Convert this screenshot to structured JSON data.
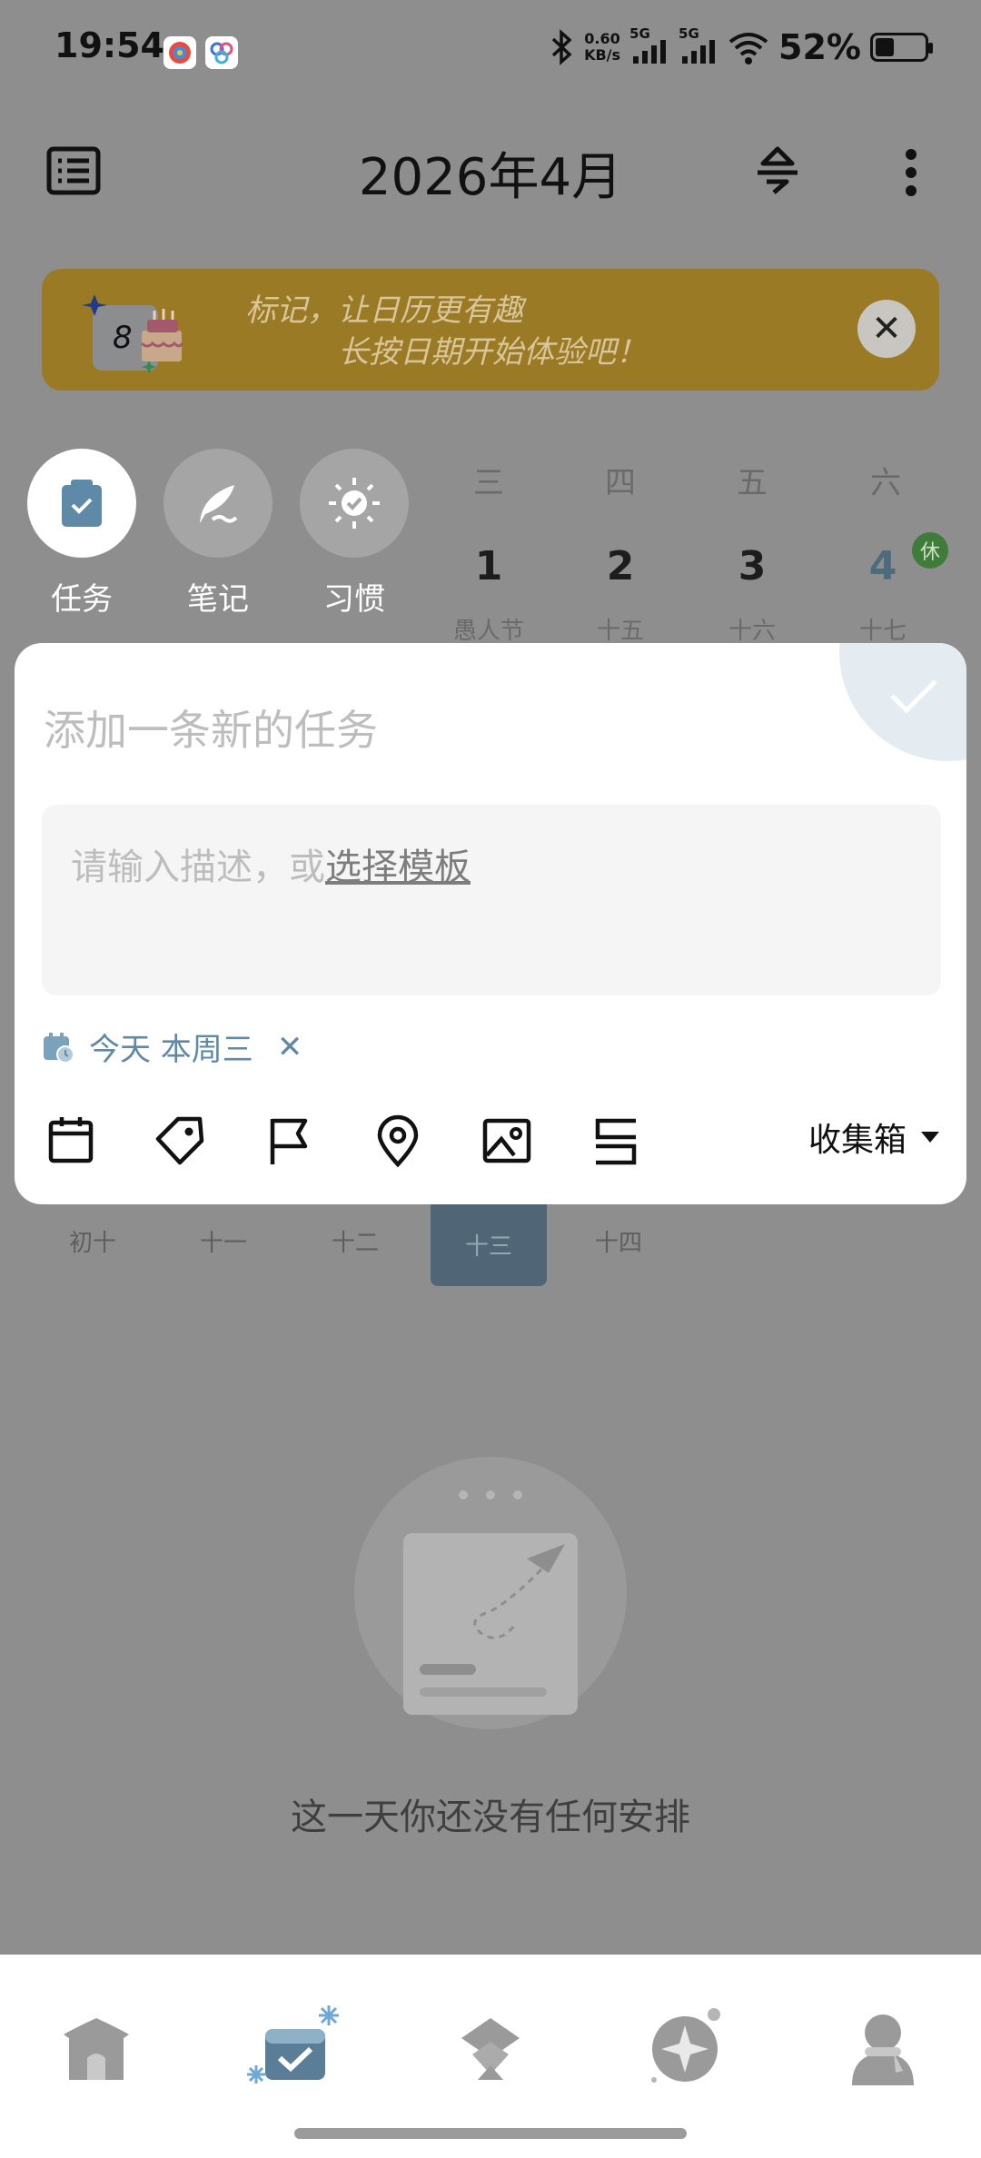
{
  "status_bar": {
    "time": "19:54",
    "net_speed_value": "0.60",
    "net_speed_unit": "KB/s",
    "sim1": "5G",
    "sim2": "5G",
    "battery": "52%",
    "battery_level": 0.52
  },
  "header": {
    "title": "2026年4月",
    "menu_icon": "list-icon",
    "weather_icon": "sunrise-icon",
    "more_icon": "more-vertical-icon"
  },
  "banner": {
    "badge_number": "8",
    "line1": "标记，让日历更有趣",
    "line2": "长按日期开始体验吧！",
    "close_symbol": "✕",
    "color": "#9b7a26"
  },
  "modes": [
    {
      "label": "任务",
      "icon": "clipboard-check-icon"
    },
    {
      "label": "笔记",
      "icon": "feather-icon"
    },
    {
      "label": "习惯",
      "icon": "habit-sun-icon"
    }
  ],
  "week": {
    "weekdays": [
      "三",
      "四",
      "五",
      "六"
    ],
    "days": [
      {
        "num": "1",
        "sub": "愚人节"
      },
      {
        "num": "2",
        "sub": "十五"
      },
      {
        "num": "3",
        "sub": "十六"
      },
      {
        "num": "4",
        "sub": "十七",
        "badge": "休"
      }
    ],
    "lower_row": [
      "初十",
      "十一",
      "十二",
      "十三",
      "十四"
    ],
    "lower_selected_index": 3
  },
  "sheet": {
    "task_placeholder": "添加一条新的任务",
    "desc_placeholder": "请输入描述，或",
    "template_link": "选择模板",
    "due_label": "今天 本周三",
    "clear_symbol": "✕",
    "inbox_label": "收集箱",
    "tools": [
      "calendar-icon",
      "tag-icon",
      "flag-icon",
      "location-pin-icon",
      "image-icon",
      "template-icon"
    ],
    "accent": "#5e8aa8"
  },
  "empty_state": {
    "text": "这一天你还没有任何安排"
  },
  "bottom_nav": {
    "items": [
      "home-tent-icon",
      "calendar-tab-icon",
      "discover-icon",
      "compass-icon",
      "profile-icon"
    ],
    "active_index": 1
  }
}
